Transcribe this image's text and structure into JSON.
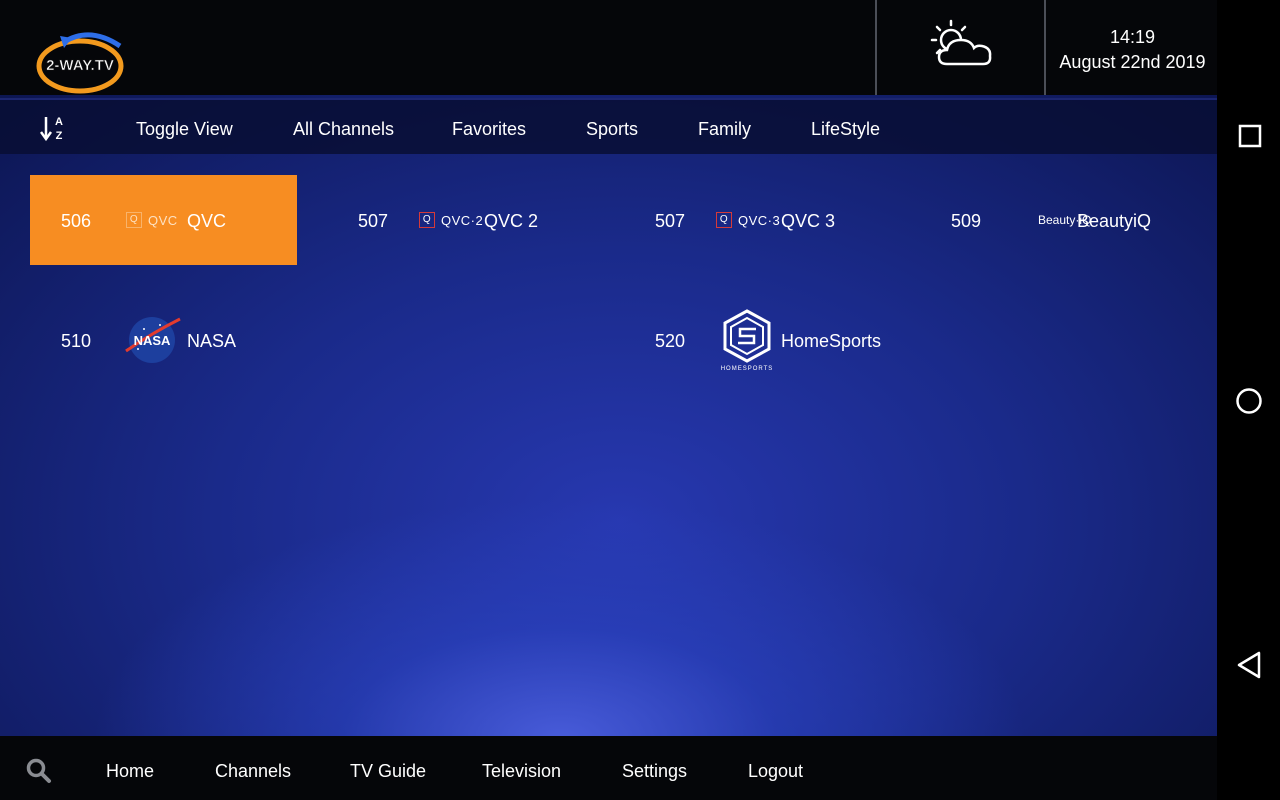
{
  "header": {
    "logo_text": "2-WAY.TV",
    "weather_icon": "partly-cloudy-icon",
    "time": "14:19",
    "date": "August 22nd 2019"
  },
  "tabs": {
    "sort_icon": "sort-az-icon",
    "items": [
      "Toggle View",
      "All Channels",
      "Favorites",
      "Sports",
      "Family",
      "LifeStyle"
    ]
  },
  "channels": [
    {
      "number": "506",
      "logo": "QVC",
      "name": "QVC",
      "selected": true
    },
    {
      "number": "507",
      "logo": "QVC·2",
      "name": "QVC 2"
    },
    {
      "number": "507",
      "logo": "QVC·3",
      "name": "QVC 3"
    },
    {
      "number": "509",
      "logo": "Beauty·iQ",
      "name": "BeautyiQ"
    },
    {
      "number": "510",
      "logo": "NASA",
      "name": "NASA"
    },
    {
      "number": "520",
      "logo": "HOMESPORTS",
      "name": "HomeSports"
    }
  ],
  "bottom_nav": {
    "search_icon": "search-icon",
    "items": [
      "Home",
      "Channels",
      "TV Guide",
      "Television",
      "Settings",
      "Logout"
    ]
  },
  "colors": {
    "accent": "#f78d22",
    "header_bg": "#050609",
    "background": "#1a2a8a"
  }
}
